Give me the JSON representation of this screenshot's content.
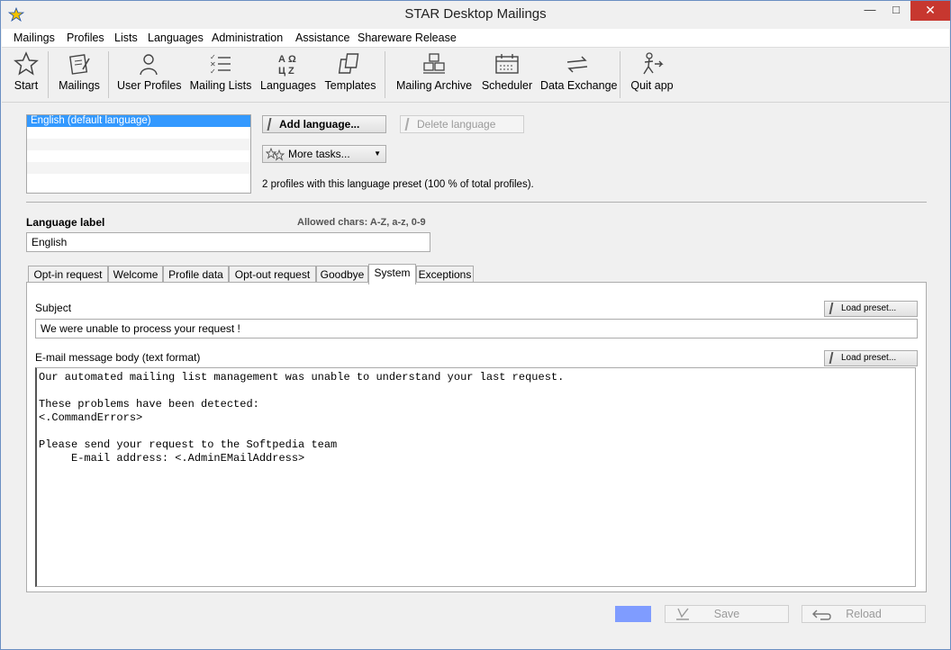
{
  "window": {
    "title": "STAR Desktop Mailings"
  },
  "menu": [
    "Mailings",
    "Profiles",
    "Lists",
    "Languages",
    "Administration",
    "Assistance",
    "Shareware Release"
  ],
  "toolbar": {
    "start": "Start",
    "mailings": "Mailings",
    "user_profiles": "User Profiles",
    "mailing_lists": "Mailing Lists",
    "languages": "Languages",
    "templates": "Templates",
    "mailing_archive": "Mailing Archive",
    "scheduler": "Scheduler",
    "data_exchange": "Data Exchange",
    "quit_app": "Quit app"
  },
  "language_list": {
    "items": [
      "English (default language)"
    ]
  },
  "actions": {
    "add_language": "Add language...",
    "delete_language": "Delete language",
    "more_tasks": "More tasks..."
  },
  "profiles_note": "2 profiles with this language preset (100 % of total profiles).",
  "language_label": {
    "label": "Language label",
    "hint": "Allowed chars: A-Z, a-z, 0-9",
    "value": "English"
  },
  "tabs": [
    "Opt-in request",
    "Welcome",
    "Profile data",
    "Opt-out request",
    "Goodbye",
    "System",
    "Exceptions"
  ],
  "active_tab": "System",
  "subject": {
    "label": "Subject",
    "value": "We were unable to process your request !",
    "load_preset": "Load preset..."
  },
  "body": {
    "label": "E-mail message body (text format)",
    "load_preset": "Load preset...",
    "text": "Our automated mailing list management was unable to understand your last request.\n\nThese problems have been detected:\n<.CommandErrors>\n\nPlease send your request to the Softpedia team\n     E-mail address: <.AdminEMailAddress>"
  },
  "footer": {
    "save": "Save",
    "reload": "Reload",
    "swatch_color": "#7f9cff"
  }
}
